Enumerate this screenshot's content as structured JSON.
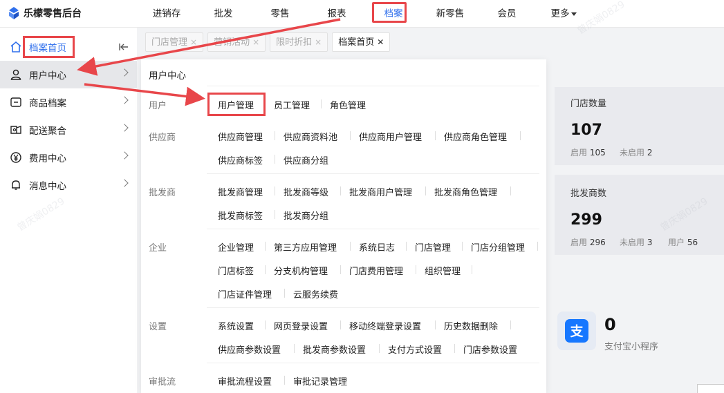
{
  "app": {
    "title": "乐檬零售后台"
  },
  "topnav": [
    "进销存",
    "批发",
    "零售",
    "报表",
    "档案",
    "新零售",
    "会员",
    "更多"
  ],
  "sidebar": {
    "items": [
      {
        "label": "档案首页",
        "icon": "home-icon"
      },
      {
        "label": "用户中心",
        "icon": "user-icon"
      },
      {
        "label": "商品档案",
        "icon": "product-icon"
      },
      {
        "label": "配送聚合",
        "icon": "delivery-icon"
      },
      {
        "label": "费用中心",
        "icon": "yen-icon"
      },
      {
        "label": "消息中心",
        "icon": "bell-icon"
      }
    ]
  },
  "tabs": [
    "门店管理",
    "营销活动",
    "限时折扣",
    "档案首页"
  ],
  "tab_close": "×",
  "tab_close_current": "✕",
  "panel": {
    "title": "用户中心",
    "groups": [
      {
        "label": "用户",
        "rows": [
          [
            "用户管理",
            "员工管理",
            "角色管理"
          ]
        ]
      },
      {
        "label": "供应商",
        "rows": [
          [
            "供应商管理",
            "供应商资料池",
            "供应商用户管理",
            "供应商角色管理"
          ],
          [
            "供应商标签",
            "供应商分组"
          ]
        ]
      },
      {
        "label": "批发商",
        "rows": [
          [
            "批发商管理",
            "批发商等级",
            "批发商用户管理",
            "批发商角色管理"
          ],
          [
            "批发商标签",
            "批发商分组"
          ]
        ]
      },
      {
        "label": "企业",
        "rows": [
          [
            "企业管理",
            "第三方应用管理",
            "系统日志",
            "门店管理",
            "门店分组管理"
          ],
          [
            "门店标签",
            "分支机构管理",
            "门店费用管理",
            "组织管理"
          ],
          [
            "门店证件管理",
            "云服务续费"
          ]
        ]
      },
      {
        "label": "设置",
        "rows": [
          [
            "系统设置",
            "网页登录设置",
            "移动终端登录设置",
            "历史数据删除"
          ],
          [
            "供应商参数设置",
            "批发商参数设置",
            "支付方式设置",
            "门店参数设置"
          ]
        ]
      },
      {
        "label": "审批流",
        "rows": [
          [
            "审批流程设置",
            "审批记录管理"
          ]
        ]
      }
    ]
  },
  "cards": [
    {
      "title": "门店数量",
      "value": "107",
      "stats": [
        {
          "label": "启用",
          "value": "105"
        },
        {
          "label": "未启用",
          "value": "2"
        }
      ]
    },
    {
      "title": "批发商数",
      "value": "299",
      "stats": [
        {
          "label": "启用",
          "value": "296"
        },
        {
          "label": "未启用",
          "value": "3"
        },
        {
          "label": "用户",
          "value": "56"
        }
      ]
    }
  ],
  "miniapp": {
    "value": "0",
    "label": "支付宝小程序",
    "icon": "alipay-icon",
    "glyph": "支"
  },
  "watermark": "曾庆娟0829",
  "colors": {
    "accent": "#2f6fec",
    "highlight": "#e8464a"
  }
}
